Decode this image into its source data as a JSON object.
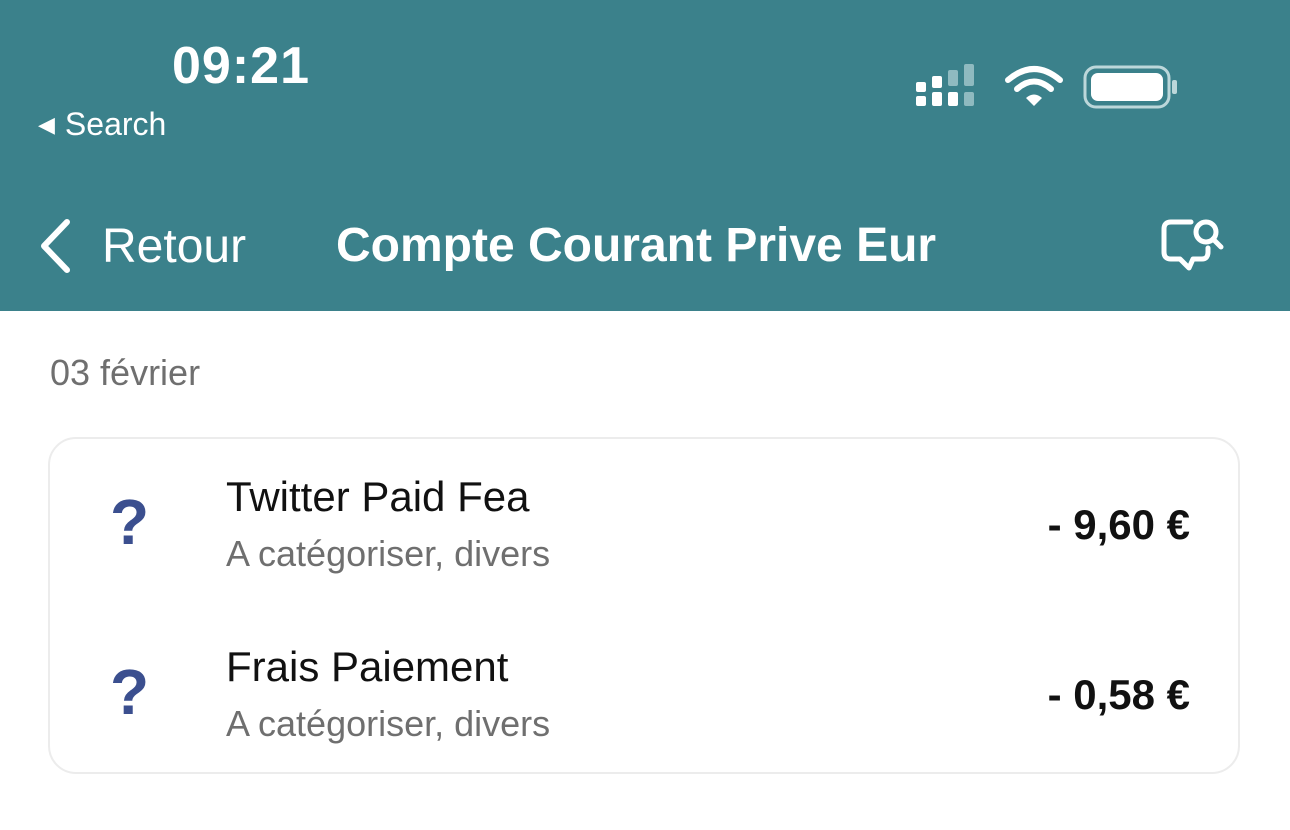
{
  "status_bar": {
    "time": "09:21",
    "back_app_label": "Search",
    "icons": [
      "cellular-signal-icon",
      "wifi-icon",
      "battery-icon"
    ]
  },
  "navbar": {
    "back_label": "Retour",
    "title": "Compte Courant Prive Eur",
    "action_icon": "chat-search-icon"
  },
  "colors": {
    "header_bg": "#3b818b",
    "icon_blue": "#3b4f8f",
    "text_primary": "#111111",
    "text_secondary": "#6f6f6f",
    "card_border": "#ececec"
  },
  "section": {
    "date": "03 février"
  },
  "transactions": [
    {
      "icon": "?",
      "title": "Twitter Paid Fea",
      "category": "A catégoriser, divers",
      "amount": "- 9,60 €"
    },
    {
      "icon": "?",
      "title": "Frais Paiement",
      "category": "A catégoriser, divers",
      "amount": "- 0,58 €"
    }
  ]
}
